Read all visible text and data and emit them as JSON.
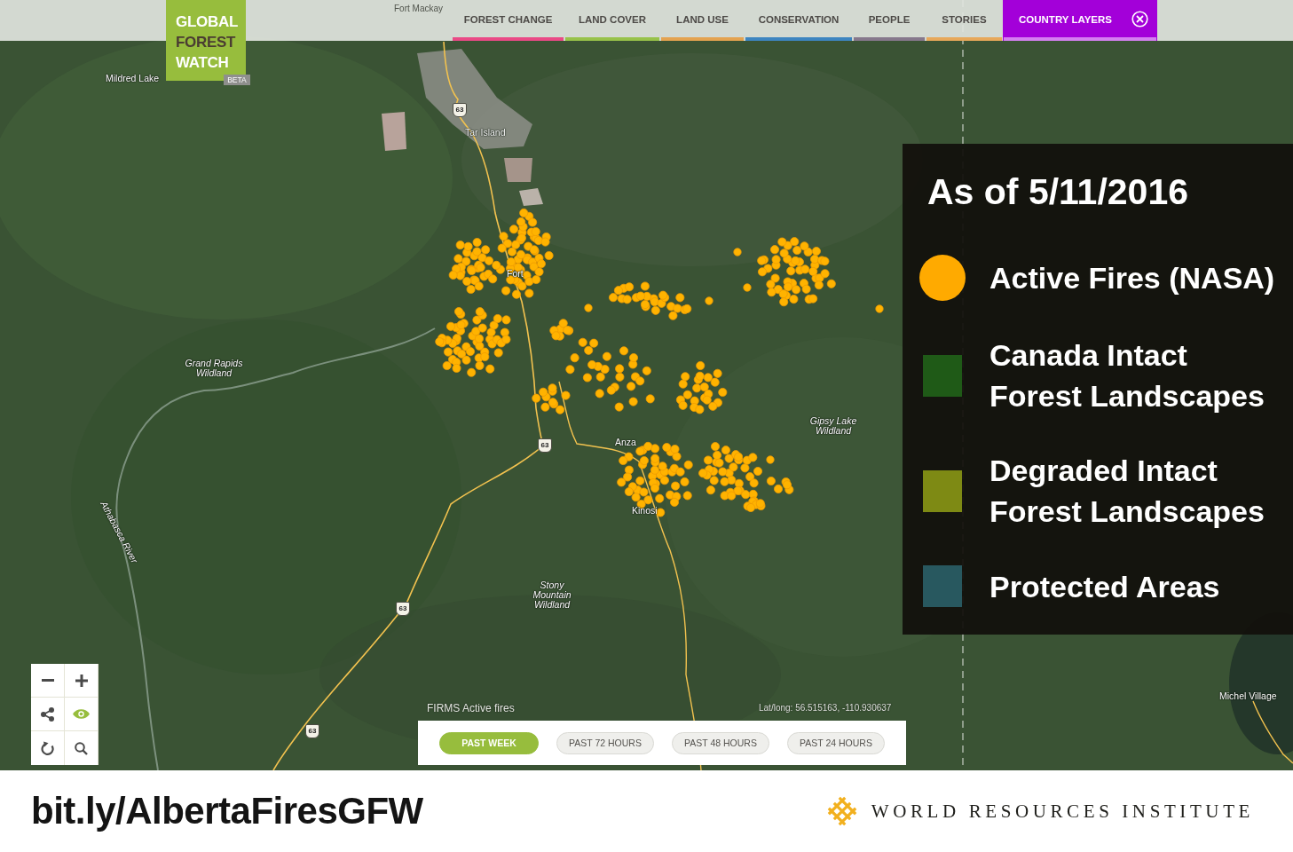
{
  "nav": {
    "logo": {
      "lines": [
        {
          "text": "GLOBAL",
          "color": "#ffffff"
        },
        {
          "text": "FOREST",
          "color": "#4a3c32"
        },
        {
          "text": "WATCH",
          "color": "#ffffff"
        }
      ],
      "badge": "BETA"
    },
    "tabs": [
      {
        "label": "FOREST CHANGE",
        "color": "#ea4a86",
        "selected": false
      },
      {
        "label": "LAND COVER",
        "color": "#97c24a",
        "selected": false
      },
      {
        "label": "LAND USE",
        "color": "#e4a350",
        "selected": false
      },
      {
        "label": "CONSERVATION",
        "color": "#3d85c0",
        "selected": false
      },
      {
        "label": "PEOPLE",
        "color": "#86788c",
        "selected": false
      },
      {
        "label": "STORIES",
        "color": "#e7a85a",
        "selected": false
      },
      {
        "label": "COUNTRY LAYERS",
        "color": "#d47ff0",
        "selected": true
      }
    ]
  },
  "map": {
    "labels": [
      {
        "text": "Fort Mackay",
        "kind": "place"
      },
      {
        "text": "Mildred Lake",
        "kind": "place"
      },
      {
        "text": "Tar Island",
        "kind": "place"
      },
      {
        "text": "Fort",
        "kind": "place"
      },
      {
        "text": "Grand Rapids Wildland",
        "kind": "wildland"
      },
      {
        "text": "Gipsy Lake Wildland",
        "kind": "wildland"
      },
      {
        "text": "Anza",
        "kind": "place"
      },
      {
        "text": "Kinosi",
        "kind": "place"
      },
      {
        "text": "Athabasca River",
        "kind": "river"
      },
      {
        "text": "Stony Mountain Wildland",
        "kind": "wildland"
      },
      {
        "text": "Michel Village",
        "kind": "place"
      }
    ],
    "highway_shields": [
      {
        "label": "63"
      },
      {
        "label": "63"
      },
      {
        "label": "63"
      },
      {
        "label": "63"
      }
    ],
    "layer_title": "FIRMS Active fires",
    "coordinates": "Lat/long: 56.515163, -110.930637"
  },
  "timeline": {
    "options": [
      {
        "label": "PAST WEEK",
        "selected": true
      },
      {
        "label": "PAST 72 HOURS",
        "selected": false
      },
      {
        "label": "PAST 48 HOURS",
        "selected": false
      },
      {
        "label": "PAST 24 HOURS",
        "selected": false
      }
    ]
  },
  "legend": {
    "title": "As of 5/11/2016",
    "items": [
      {
        "label": "Active Fires (NASA)",
        "kind": "circle",
        "color": "#ffaa00"
      },
      {
        "label": "Canada Intact Forest Landscapes",
        "kind": "square",
        "color": "#1f5a17"
      },
      {
        "label": "Degraded Intact Forest Landscapes",
        "kind": "square",
        "color": "#7e8a14"
      },
      {
        "label": "Protected Areas",
        "kind": "square",
        "color": "#28585f"
      }
    ]
  },
  "footer": {
    "link": "bit.ly/AlbertaFiresGFW",
    "organization": "WORLD RESOURCES INSTITUTE"
  }
}
